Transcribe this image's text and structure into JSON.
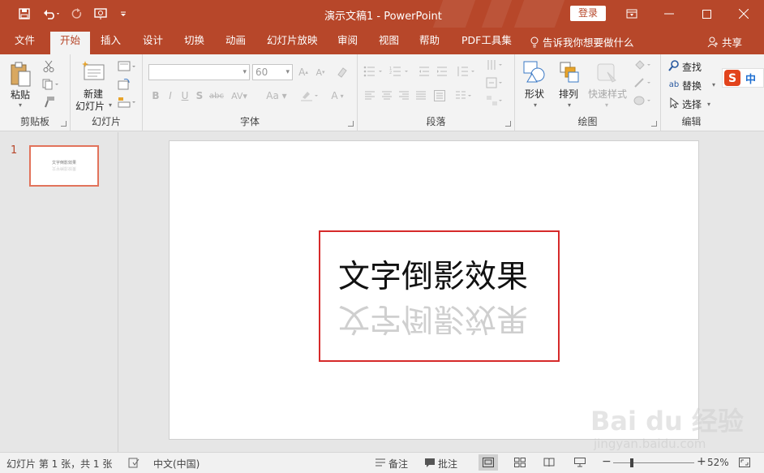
{
  "window": {
    "doc_title": "演示文稿1  -  PowerPoint",
    "login": "登录",
    "accent": "#b7472a"
  },
  "quick_access": [
    "save-icon",
    "undo-icon",
    "redo-icon",
    "presentation-from-start-icon",
    "customize-icon"
  ],
  "tabs": [
    "文件",
    "开始",
    "插入",
    "设计",
    "切换",
    "动画",
    "幻灯片放映",
    "审阅",
    "视图",
    "帮助",
    "PDF工具集"
  ],
  "active_tab": "开始",
  "tell_me": "告诉我你想要做什么",
  "share": "共享",
  "ribbon": {
    "clipboard": {
      "paste": "粘贴",
      "label": "剪贴板"
    },
    "slides": {
      "new_slide_line1": "新建",
      "new_slide_line2": "幻灯片",
      "label": "幻灯片"
    },
    "font": {
      "font_name": "",
      "font_size": "60",
      "label": "字体"
    },
    "paragraph": {
      "label": "段落"
    },
    "drawing": {
      "shape": "形状",
      "arrange": "排列",
      "quick_style": "快速样式",
      "label": "绘图"
    },
    "editing": {
      "find": "查找",
      "replace": "替换",
      "select": "选择",
      "label": "编辑"
    },
    "ime_text": "中"
  },
  "thumbnail": {
    "number": "1",
    "text": "文字倒影效果"
  },
  "slide": {
    "text": "文字倒影效果",
    "reflection": "文字倒影效果"
  },
  "watermark": {
    "top": "Bai du 经验",
    "bottom": "jingyan.baidu.com"
  },
  "status": {
    "slide_info": "幻灯片 第 1 张，共 1 张",
    "language": "中文(中国)",
    "notes": "备注",
    "comments": "批注",
    "zoom": "52%",
    "zoom_fraction": 0.52
  }
}
